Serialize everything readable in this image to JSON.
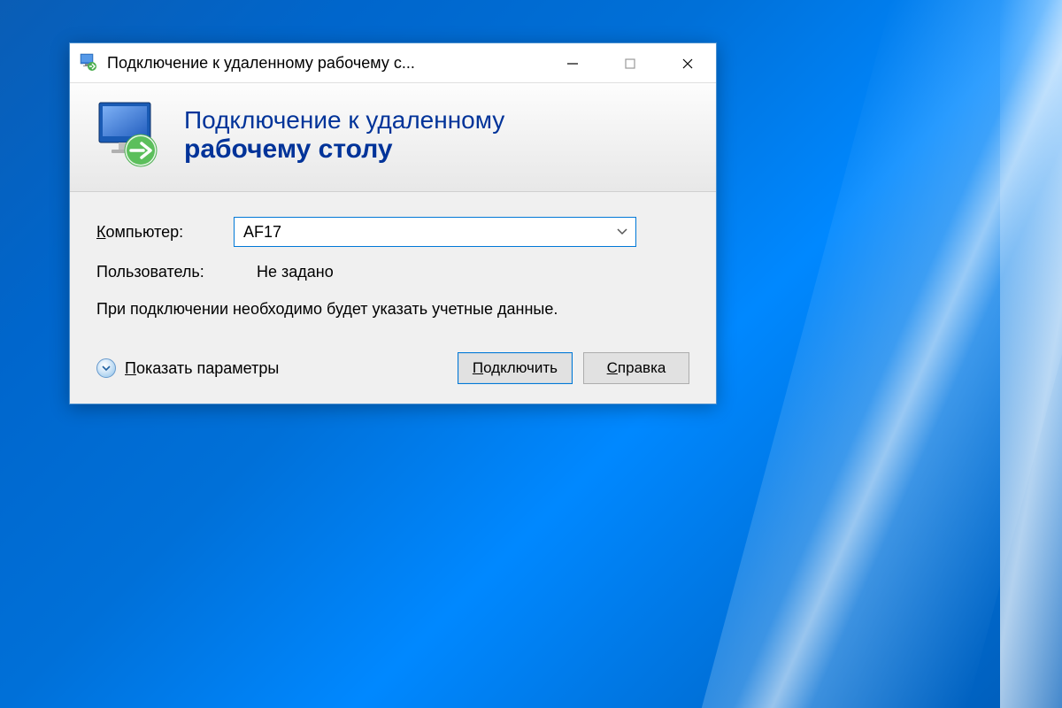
{
  "titlebar": {
    "title": "Подключение к удаленному рабочему с..."
  },
  "banner": {
    "line1": "Подключение к удаленному",
    "line2": "рабочему столу"
  },
  "form": {
    "computer_label": "омпьютер:",
    "computer_value": "AF17",
    "user_label": "Пользователь:",
    "user_value": "Не задано",
    "info_text": "При подключении необходимо будет указать учетные данные."
  },
  "footer": {
    "show_options": "оказать параметры",
    "connect": "одключить",
    "help": "правка"
  }
}
